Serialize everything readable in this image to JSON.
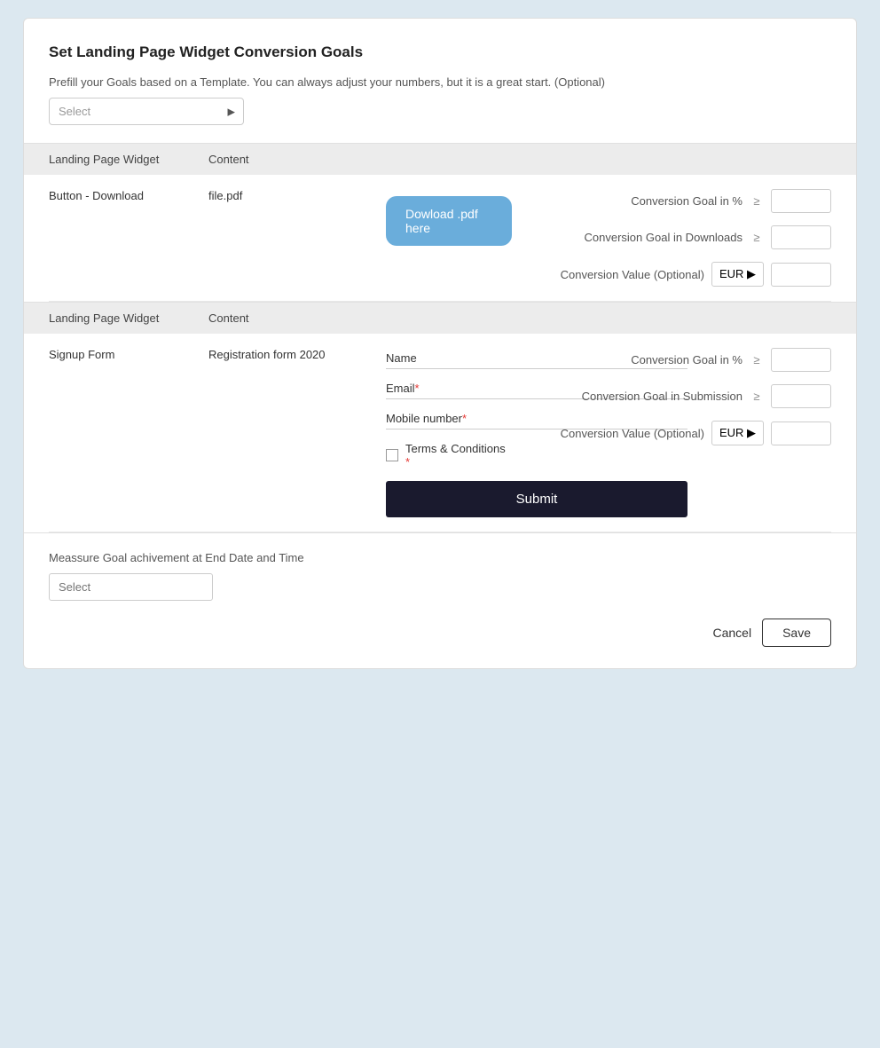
{
  "page": {
    "title": "Set Landing Page Widget Conversion Goals",
    "prefill_desc": "Prefill your Goals based on a Template. You can always adjust your numbers, but it is a great start. (Optional)",
    "template_select_placeholder": "Select"
  },
  "section1": {
    "header_col1": "Landing Page Widget",
    "header_col2": "Content",
    "widget_name": "Button - Download",
    "widget_content": "file.pdf",
    "download_btn_label": "Dowload .pdf here",
    "goals": [
      {
        "label": "Conversion Goal in %",
        "gte": "≥"
      },
      {
        "label": "Conversion Goal in Downloads",
        "gte": "≥"
      },
      {
        "label": "Conversion Value (Optional)",
        "currency": "EUR ▶"
      }
    ]
  },
  "section2": {
    "header_col1": "Landing Page Widget",
    "header_col2": "Content",
    "widget_name": "Signup Form",
    "widget_content": "Registration form 2020",
    "form_fields": [
      {
        "label": "Name",
        "required": false
      },
      {
        "label": "Email",
        "required": true
      },
      {
        "label": "Mobile number",
        "required": true
      }
    ],
    "terms_label": "Terms & Conditions",
    "terms_required": true,
    "submit_label": "Submit",
    "goals": [
      {
        "label": "Conversion Goal in %",
        "gte": "≥"
      },
      {
        "label": "Conversion Goal in Submission",
        "gte": "≥"
      },
      {
        "label": "Conversion Value (Optional)",
        "currency": "EUR ▶"
      }
    ]
  },
  "bottom": {
    "measure_label": "Meassure Goal achivement at End Date and Time",
    "measure_placeholder": "Select"
  },
  "actions": {
    "cancel_label": "Cancel",
    "save_label": "Save"
  },
  "icons": {
    "arrow_right": "▶",
    "gte": "≥"
  }
}
